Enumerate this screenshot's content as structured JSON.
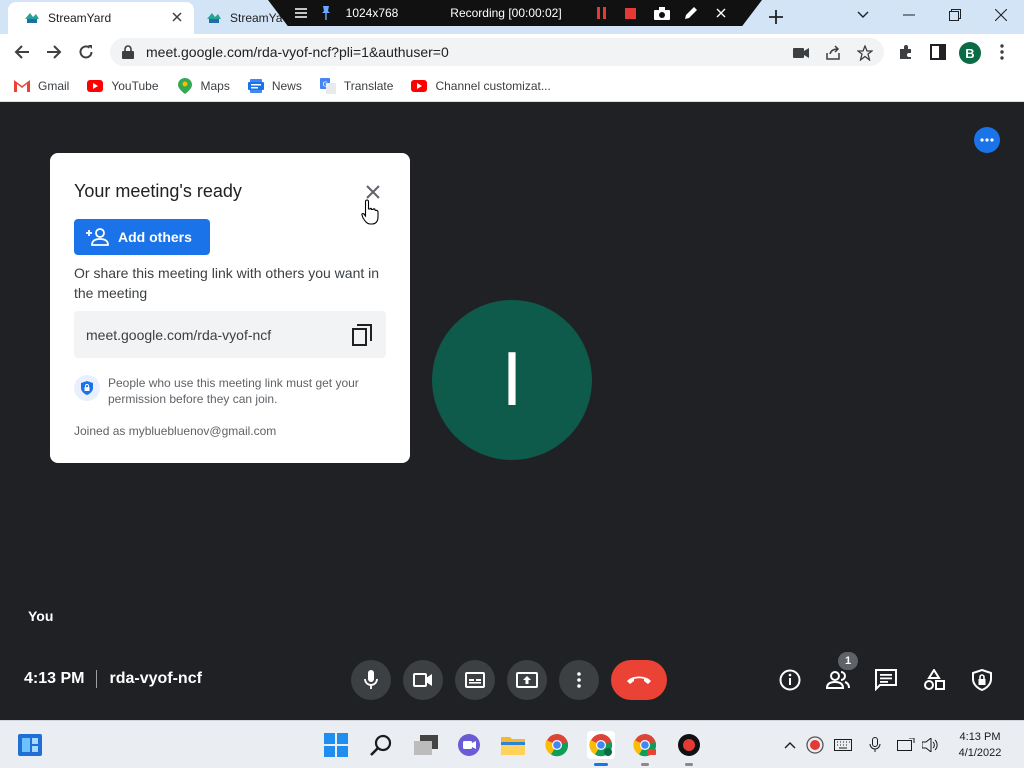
{
  "browser": {
    "tabs": [
      {
        "title": "StreamYard",
        "active": true
      },
      {
        "title": "StreamYa"
      }
    ],
    "url": "meet.google.com/rda-vyof-ncf?pli=1&authuser=0",
    "profile_initial": "B",
    "bookmarks": [
      {
        "label": "Gmail",
        "icon": "gmail-icon"
      },
      {
        "label": "YouTube",
        "icon": "youtube-icon"
      },
      {
        "label": "Maps",
        "icon": "maps-icon"
      },
      {
        "label": "News",
        "icon": "news-icon"
      },
      {
        "label": "Translate",
        "icon": "translate-icon"
      },
      {
        "label": "Channel customizat...",
        "icon": "youtube-icon"
      }
    ]
  },
  "recorder": {
    "resolution": "1024x768",
    "status": "Recording [00:00:02]"
  },
  "dialog": {
    "title": "Your meeting's ready",
    "add_button": "Add others",
    "share_text": "Or share this meeting link with others you want in the meeting",
    "link": "meet.google.com/rda-vyof-ncf",
    "permission_text": "People who use this meeting link must get your permission before they can join.",
    "joined_as": "Joined as mybluebluenov@gmail.com"
  },
  "participant": {
    "initial": "I",
    "name_label": "You"
  },
  "meeting": {
    "time": "4:13 PM",
    "code": "rda-vyof-ncf",
    "participant_count": "1"
  },
  "colors": {
    "meet_bg": "#202124",
    "accent": "#1a73e8",
    "end_call": "#ea4335",
    "avatar": "#0e5b4b"
  },
  "taskbar": {
    "time": "4:13 PM",
    "date": "4/1/2022"
  }
}
